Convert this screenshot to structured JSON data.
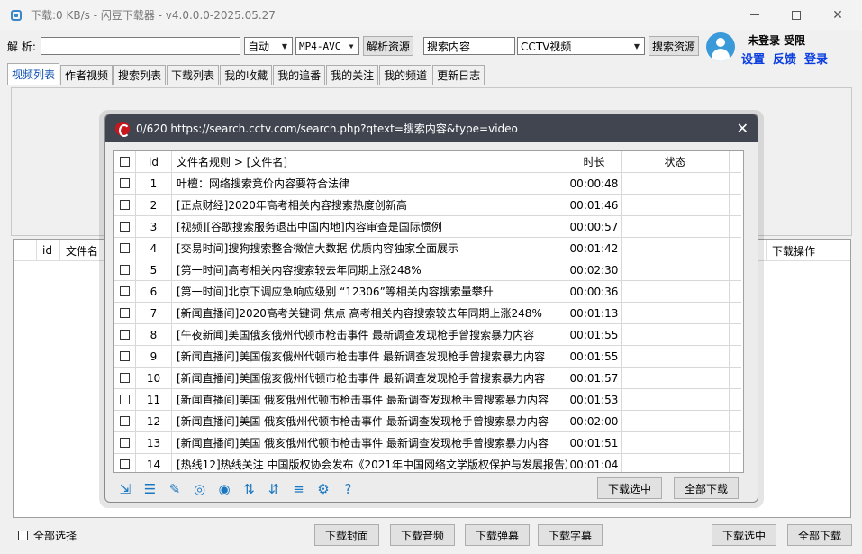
{
  "window": {
    "title": "下载:0 KB/s - 闪豆下载器 - v4.0.0.0-2025.05.27"
  },
  "toolbar": {
    "parse_label": "解 析:",
    "url_value": "",
    "mode_value": "自动",
    "format_value": "MP4-AVC",
    "parse_button": "解析资源",
    "search_value": "搜索内容",
    "source_value": "CCTV视频",
    "search_button": "搜索资源"
  },
  "user": {
    "status": "未登录 受限",
    "settings": "设置",
    "feedback": "反馈",
    "login": "登录"
  },
  "tabs": [
    "视频列表",
    "作者视频",
    "搜索列表",
    "下载列表",
    "我的收藏",
    "我的追番",
    "我的关注",
    "我的频道",
    "更新日志"
  ],
  "main_list": {
    "columns": [
      "",
      "id",
      "文件名",
      "下载操作"
    ]
  },
  "bottom": {
    "select_all": "全部选择",
    "download_cover": "下载封面",
    "download_audio": "下载音频",
    "download_danmaku": "下载弹幕",
    "download_subtitle": "下载字幕",
    "download_selected": "下载选中",
    "download_all": "全部下载"
  },
  "dialog": {
    "title": "0/620 https://search.cctv.com/search.php?qtext=搜索内容&type=video",
    "columns": {
      "id": "id",
      "name": "文件名规则  >  [文件名]",
      "duration": "时长",
      "status": "状态"
    },
    "rows": [
      {
        "id": "1",
        "name": "叶檀：网络搜索竞价内容要符合法律",
        "duration": "00:00:48",
        "status": ""
      },
      {
        "id": "2",
        "name": "[正点财经]2020年高考相关内容搜索热度创新高",
        "duration": "00:01:46",
        "status": ""
      },
      {
        "id": "3",
        "name": "[视频][谷歌搜索服务退出中国内地]内容审查是国际惯例",
        "duration": "00:00:57",
        "status": ""
      },
      {
        "id": "4",
        "name": "[交易时间]搜狗搜索整合微信大数据 优质内容独家全面展示",
        "duration": "00:01:42",
        "status": ""
      },
      {
        "id": "5",
        "name": "[第一时间]高考相关内容搜索较去年同期上涨248%",
        "duration": "00:02:30",
        "status": ""
      },
      {
        "id": "6",
        "name": "[第一时间]北京下调应急响应级别 “12306”等相关内容搜索量攀升",
        "duration": "00:00:36",
        "status": ""
      },
      {
        "id": "7",
        "name": "[新闻直播间]2020高考关键词·焦点 高考相关内容搜索较去年同期上涨248%",
        "duration": "00:01:13",
        "status": ""
      },
      {
        "id": "8",
        "name": "[午夜新闻]美国俄亥俄州代顿市枪击事件 最新调查发现枪手曾搜索暴力内容",
        "duration": "00:01:55",
        "status": ""
      },
      {
        "id": "9",
        "name": "[新闻直播间]美国俄亥俄州代顿市枪击事件 最新调查发现枪手曾搜索暴力内容",
        "duration": "00:01:55",
        "status": ""
      },
      {
        "id": "10",
        "name": "[新闻直播间]美国俄亥俄州代顿市枪击事件 最新调查发现枪手曾搜索暴力内容",
        "duration": "00:01:57",
        "status": ""
      },
      {
        "id": "11",
        "name": "[新闻直播间]美国 俄亥俄州代顿市枪击事件 最新调查发现枪手曾搜索暴力内容",
        "duration": "00:01:53",
        "status": ""
      },
      {
        "id": "12",
        "name": "[新闻直播间]美国 俄亥俄州代顿市枪击事件 最新调查发现枪手曾搜索暴力内容",
        "duration": "00:02:00",
        "status": ""
      },
      {
        "id": "13",
        "name": "[新闻直播间]美国 俄亥俄州代顿市枪击事件 最新调查发现枪手曾搜索暴力内容",
        "duration": "00:01:51",
        "status": ""
      },
      {
        "id": "14",
        "name": "[热线12]热线关注 中国版权协会发布《2021年中国网络文学版权保护与发展报告》",
        "duration": "00:01:04",
        "status": ""
      }
    ],
    "tool_icons": [
      "export-icon",
      "search-list-icon",
      "edit-icon",
      "browser-icon",
      "user-circle-icon",
      "sort-icon",
      "sort-alt-icon",
      "list-icon",
      "settings-doc-icon",
      "help-doc-icon"
    ],
    "download_selected": "下载选中",
    "download_all": "全部下载"
  },
  "colors": {
    "accent": "#0a3de0",
    "dialog_title_bg": "#404550",
    "cctv_red": "#c8161d",
    "icon_blue": "#1a78c2"
  }
}
